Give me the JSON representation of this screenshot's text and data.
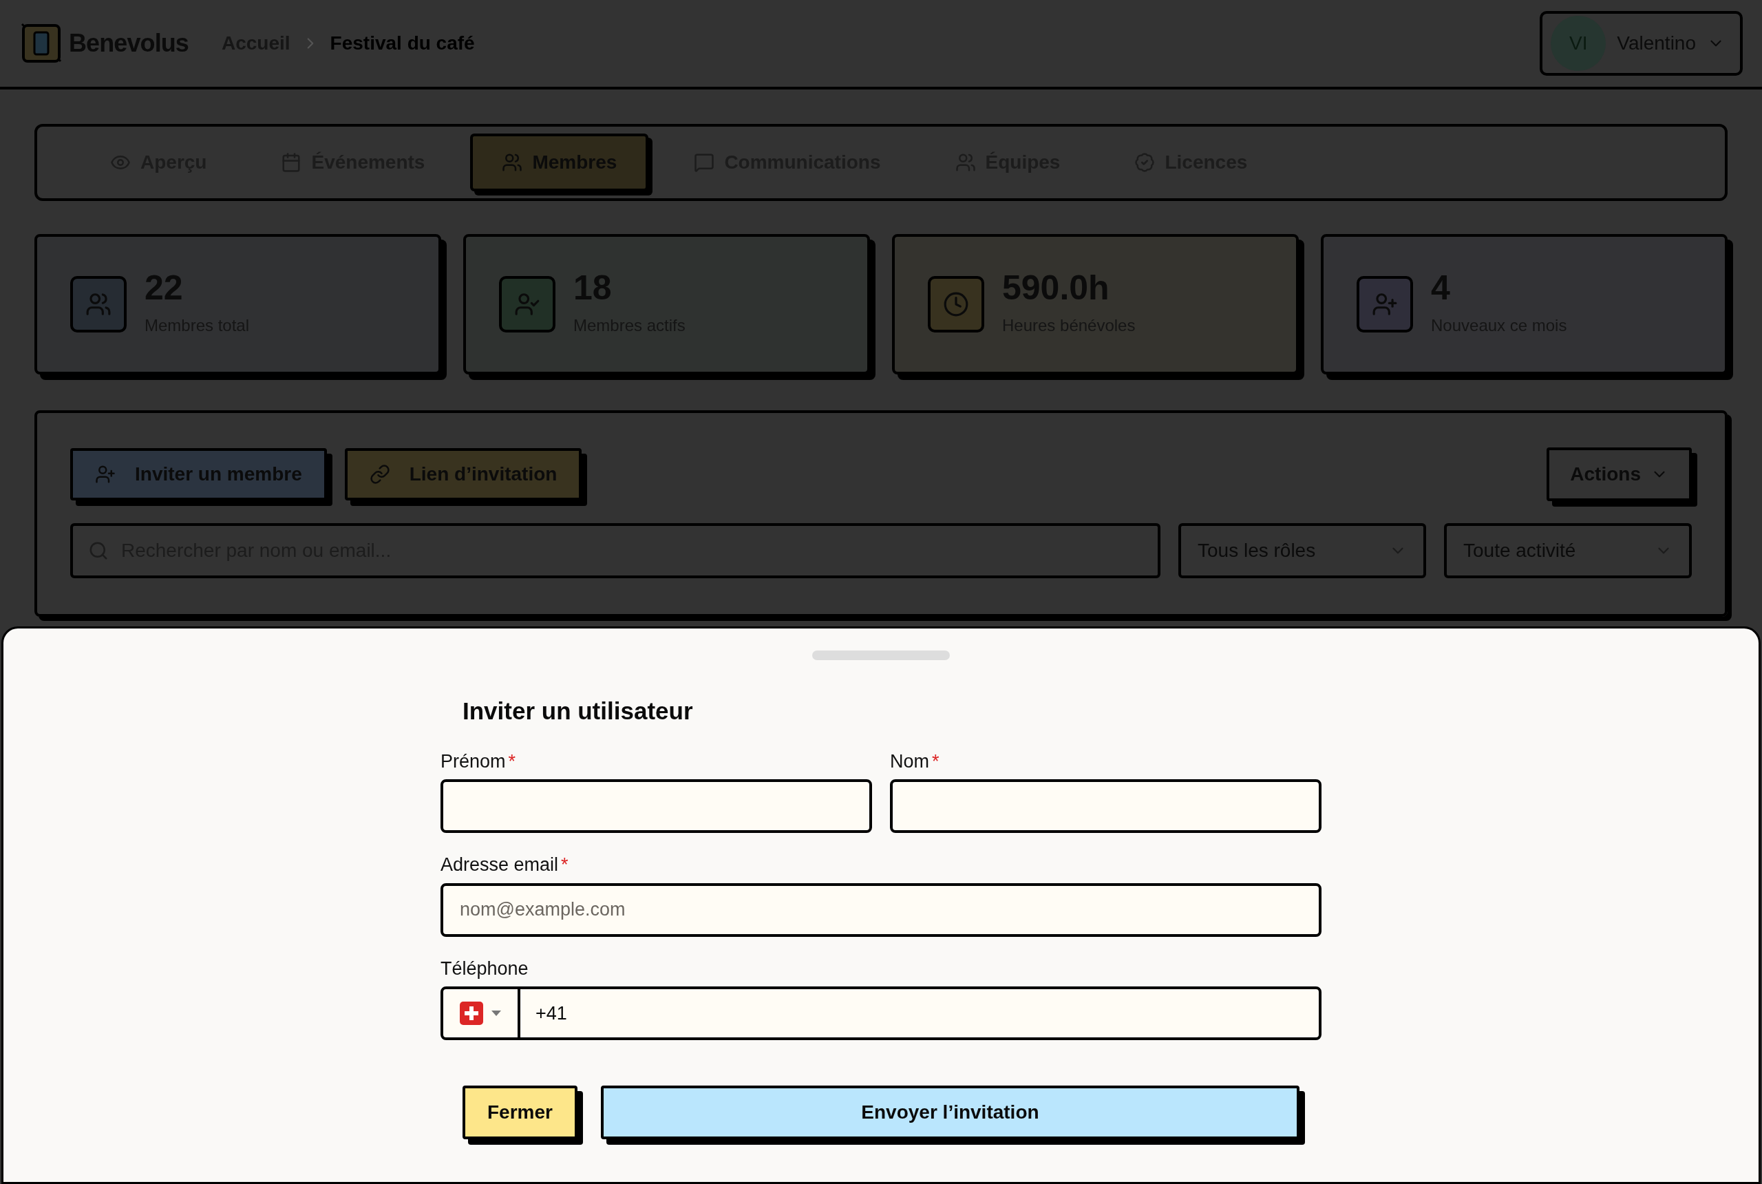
{
  "app": {
    "name": "Benevolus"
  },
  "breadcrumb": [
    {
      "label": "Accueil",
      "current": false
    },
    {
      "label": "Festival du café",
      "current": true
    }
  ],
  "user": {
    "initials": "VI",
    "name": "Valentino"
  },
  "tabs": [
    {
      "label": "Aperçu",
      "selected": false
    },
    {
      "label": "Événements",
      "selected": false
    },
    {
      "label": "Membres",
      "selected": true
    },
    {
      "label": "Communications",
      "selected": false
    },
    {
      "label": "Équipes",
      "selected": false
    },
    {
      "label": "Licences",
      "selected": false
    }
  ],
  "stats": [
    {
      "value": "22",
      "label": "Membres total",
      "color": "#262c33"
    },
    {
      "value": "18",
      "label": "Membres actifs",
      "color": "#213026"
    },
    {
      "value": "590.0h",
      "label": "Heures bénévoles",
      "color": "#38321f"
    },
    {
      "value": "4",
      "label": "Nouveaux ce mois",
      "color": "#2f2e3a"
    }
  ],
  "toolbar": {
    "buttons": [
      {
        "label": "Inviter un membre",
        "color": "#2b3440"
      },
      {
        "label": "Lien d’invitation",
        "color": "#39331f"
      }
    ],
    "actions": "Actions",
    "search": {
      "placeholder": "Rechercher par nom ou email..."
    },
    "filters": [
      {
        "value": "Tous les rôles"
      },
      {
        "value": "Toute activité"
      }
    ]
  },
  "dialog": {
    "title": "Inviter un utilisateur",
    "required_marker": "*",
    "fields": [
      {
        "label": "Prénom",
        "required": true
      },
      {
        "label": "Nom",
        "required": true
      },
      {
        "label": "Adresse email",
        "required": true,
        "placeholder": "nom@example.com"
      }
    ],
    "phone": {
      "label": "Téléphone",
      "value": "+41"
    },
    "buttons": [
      {
        "label": "Fermer",
        "kind": "secondary"
      },
      {
        "label": "Envoyer l’invitation",
        "kind": "primary"
      }
    ]
  }
}
